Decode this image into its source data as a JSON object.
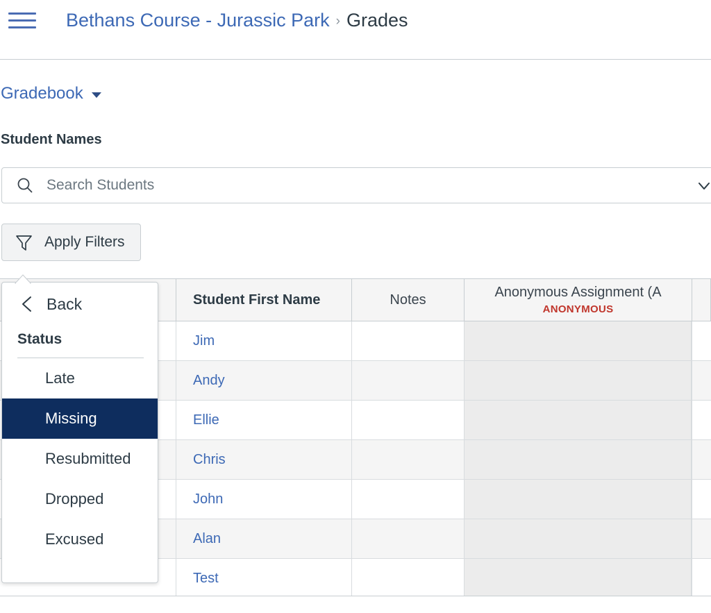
{
  "header": {
    "menu_icon": "hamburger-menu-icon",
    "breadcrumb": {
      "course_label": "Bethans Course - Jurassic Park",
      "separator": "›",
      "current_label": "Grades"
    }
  },
  "toolbar": {
    "gradebook_select_label": "Gradebook",
    "gradebook_caret_icon": "chevron-down-icon",
    "student_names_label": "Student Names",
    "search": {
      "icon": "search-icon",
      "placeholder": "Search Students",
      "value": "",
      "expand_icon": "chevron-down-icon"
    },
    "apply_filters": {
      "icon": "filter-funnel-icon",
      "label": "Apply Filters"
    }
  },
  "filter_popover": {
    "back_icon": "chevron-left-icon",
    "back_label": "Back",
    "title": "Status",
    "items": [
      {
        "label": "Late",
        "selected": false
      },
      {
        "label": "Missing",
        "selected": true
      },
      {
        "label": "Resubmitted",
        "selected": false
      },
      {
        "label": "Dropped",
        "selected": false
      },
      {
        "label": "Excused",
        "selected": false
      }
    ],
    "selected_color": "#0E2D5E"
  },
  "gradebook": {
    "columns": [
      {
        "key": "select",
        "label": ""
      },
      {
        "key": "first_name",
        "label": "Student First Name"
      },
      {
        "key": "notes",
        "label": "Notes"
      },
      {
        "key": "anonymous",
        "label": "Anonymous Assignment (A",
        "tag": "ANONYMOUS",
        "tag_color": "#C0362C"
      },
      {
        "key": "extra",
        "label": ""
      }
    ],
    "rows": [
      {
        "first_name": "Jim",
        "notes": "",
        "anonymous": ""
      },
      {
        "first_name": "Andy",
        "notes": "",
        "anonymous": ""
      },
      {
        "first_name": "Ellie",
        "notes": "",
        "anonymous": ""
      },
      {
        "first_name": "Chris",
        "notes": "",
        "anonymous": ""
      },
      {
        "first_name": "John",
        "notes": "",
        "anonymous": ""
      },
      {
        "first_name": "Alan",
        "notes": "",
        "anonymous": ""
      },
      {
        "first_name": "Test",
        "notes": "",
        "anonymous": ""
      }
    ]
  }
}
